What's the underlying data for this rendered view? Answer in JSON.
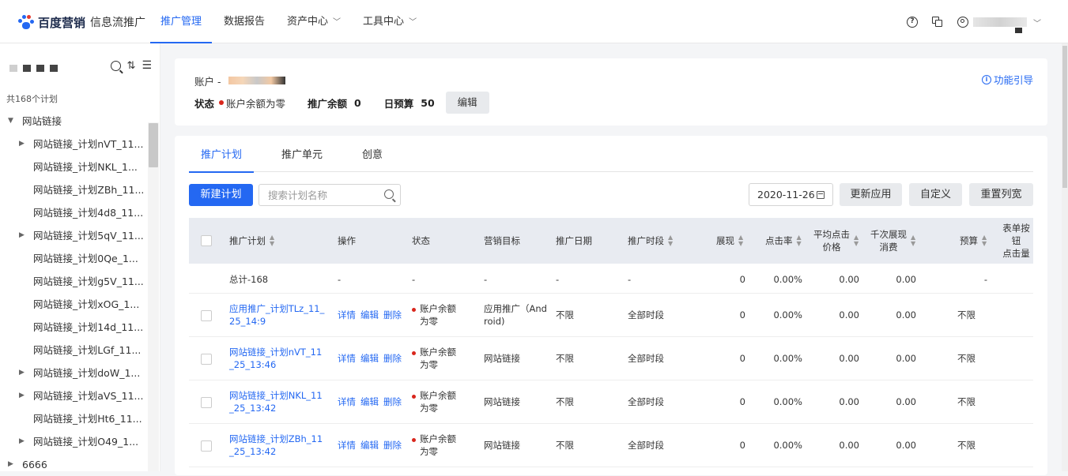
{
  "brand": {
    "name": "百度营销",
    "product": "信息流推广",
    "colors": {
      "primary": "#2468f2",
      "danger": "#d9261c"
    }
  },
  "nav": {
    "items": [
      {
        "label": "推广管理",
        "active": true
      },
      {
        "label": "数据报告"
      },
      {
        "label": "资产中心",
        "chevron": "chevron-down-icon"
      },
      {
        "label": "工具中心",
        "chevron": "chevron-down-icon"
      }
    ]
  },
  "sidebar": {
    "count_text": "共168个计划",
    "tree": [
      {
        "label": "网站链接",
        "expanded": true,
        "level": 0
      },
      {
        "label": "网站链接_计划nVT_11...",
        "level": 1,
        "has_children": true
      },
      {
        "label": "网站链接_计划NKL_1...",
        "level": 1
      },
      {
        "label": "网站链接_计划ZBh_11...",
        "level": 1
      },
      {
        "label": "网站链接_计划4d8_11...",
        "level": 1
      },
      {
        "label": "网站链接_计划5qV_11...",
        "level": 1,
        "has_children": true
      },
      {
        "label": "网站链接_计划0Qe_1...",
        "level": 1
      },
      {
        "label": "网站链接_计划g5V_11...",
        "level": 1
      },
      {
        "label": "网站链接_计划xOG_1...",
        "level": 1
      },
      {
        "label": "网站链接_计划14d_11...",
        "level": 1
      },
      {
        "label": "网站链接_计划LGf_11...",
        "level": 1
      },
      {
        "label": "网站链接_计划doW_1...",
        "level": 1,
        "has_children": true
      },
      {
        "label": "网站链接_计划aVS_11...",
        "level": 1,
        "has_children": true
      },
      {
        "label": "网站链接_计划Ht6_11...",
        "level": 1
      },
      {
        "label": "网站链接_计划O49_1...",
        "level": 1,
        "has_children": true
      },
      {
        "label": "6666",
        "level": 0,
        "has_children": true
      }
    ]
  },
  "account": {
    "label": "账户 -",
    "status_label": "状态",
    "status_value": "账户余额为零",
    "balance_label": "推广余额",
    "balance_value": "0",
    "budget_label": "日预算",
    "budget_value": "50",
    "edit_label": "编辑",
    "guide_label": "功能引导"
  },
  "tabs": [
    "推广计划",
    "推广单元",
    "创意"
  ],
  "toolbar": {
    "new_label": "新建计划",
    "search_placeholder": "搜索计划名称",
    "date": "2020-11-26",
    "update_label": "更新应用",
    "custom_label": "自定义",
    "reset_label": "重置列宽"
  },
  "table": {
    "headers": {
      "plan": "推广计划",
      "op": "操作",
      "status": "状态",
      "goal": "营销目标",
      "date": "推广日期",
      "period": "推广时段",
      "impr": "展现",
      "ctr": "点击率",
      "cpc1": "平均点击",
      "cpc2": "价格",
      "cpm1": "千次展现",
      "cpm2": "消费",
      "budget": "预算",
      "form1": "表单按钮",
      "form2": "点击量"
    },
    "total": {
      "label": "总计-168",
      "op": "-",
      "status": "-",
      "goal": "-",
      "date": "-",
      "period": "-",
      "impr": "0",
      "ctr": "0.00%",
      "cpc": "0.00",
      "cpm": "0.00",
      "budget": "-"
    },
    "ops": [
      "详情",
      "编辑",
      "删除"
    ],
    "rows": [
      {
        "name1": "应用推广_计划TLz_11_",
        "name2": "25_14:9",
        "status1": "账户余额",
        "status2": "为零",
        "goal1": "应用推广（And",
        "goal2": "roid)",
        "date": "不限",
        "period": "全部时段",
        "impr": "0",
        "ctr": "0.00%",
        "cpc": "0.00",
        "cpm": "0.00",
        "budget": "不限"
      },
      {
        "name1": "网站链接_计划nVT_11",
        "name2": "_25_13:46",
        "status1": "账户余额",
        "status2": "为零",
        "goal1": "网站链接",
        "goal2": "",
        "date": "不限",
        "period": "全部时段",
        "impr": "0",
        "ctr": "0.00%",
        "cpc": "0.00",
        "cpm": "0.00",
        "budget": "不限"
      },
      {
        "name1": "网站链接_计划NKL_11",
        "name2": "_25_13:42",
        "status1": "账户余额",
        "status2": "为零",
        "goal1": "网站链接",
        "goal2": "",
        "date": "不限",
        "period": "全部时段",
        "impr": "0",
        "ctr": "0.00%",
        "cpc": "0.00",
        "cpm": "0.00",
        "budget": "不限"
      },
      {
        "name1": "网站链接_计划ZBh_11",
        "name2": "_25_13:42",
        "status1": "账户余额",
        "status2": "为零",
        "goal1": "网站链接",
        "goal2": "",
        "date": "不限",
        "period": "全部时段",
        "impr": "0",
        "ctr": "0.00%",
        "cpc": "0.00",
        "cpm": "0.00",
        "budget": "不限"
      }
    ]
  }
}
